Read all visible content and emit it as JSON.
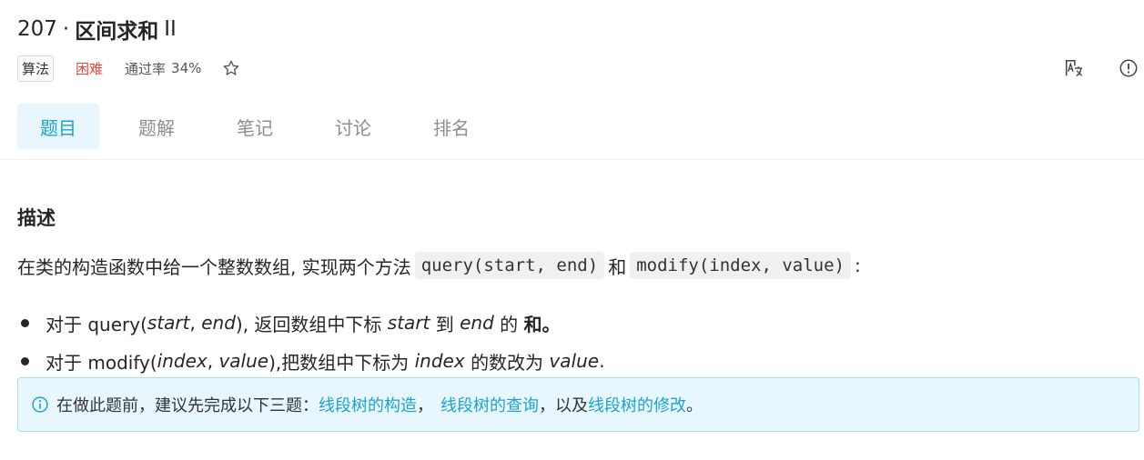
{
  "problem": {
    "number": "207",
    "separator": "·",
    "name": "区间求和",
    "suffix": "II"
  },
  "meta": {
    "tag": "算法",
    "difficulty": "困难",
    "pass_rate_label": "通过率",
    "pass_rate_value": "34%"
  },
  "icons": {
    "star": "star-outline-icon",
    "translate": "translate-icon",
    "info": "info-circle-icon"
  },
  "tabs": [
    {
      "label": "题目",
      "active": true
    },
    {
      "label": "题解",
      "active": false
    },
    {
      "label": "笔记",
      "active": false
    },
    {
      "label": "讨论",
      "active": false
    },
    {
      "label": "排名",
      "active": false
    }
  ],
  "description": {
    "heading": "描述",
    "intro_text": "在类的构造函数中给一个整数数组, 实现两个方法",
    "code_query": "query(start, end)",
    "conjunction": "和",
    "code_modify": "modify(index, value)",
    "colon": ":"
  },
  "bullets": {
    "b1": {
      "prefix": "对于 query(",
      "arg1": "start",
      "comma": ", ",
      "arg2": "end",
      "mid": "), 返回数组中下标",
      "start_word": "start",
      "to": "到",
      "end_word": "end",
      "of": "的",
      "sum": "和。"
    },
    "b2": {
      "prefix": "对于 modify(",
      "arg1": "index",
      "comma": ", ",
      "arg2": "value",
      "mid": "),把数组中下标为",
      "index_word": "index",
      "change": "的数改为",
      "value_word": "value",
      "period": "."
    }
  },
  "notice": {
    "text_before": "在做此题前，建议先完成以下三题：",
    "link1": "线段树的构造",
    "sep1": "，",
    "link2": "线段树的查询",
    "sep2": "，以及",
    "link3": "线段树的修改",
    "end": "。"
  },
  "colors": {
    "accent": "#1aa3d4",
    "difficulty_hard": "#ea4335",
    "notice_bg": "#e8f6fd"
  }
}
